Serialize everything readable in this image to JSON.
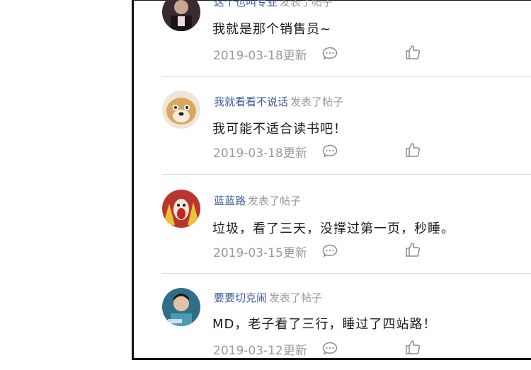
{
  "posts": [
    {
      "username": "这个也叫专业",
      "action": "发表了帖子",
      "content": "我就是那个销售员~",
      "date": "2019-03-18更新",
      "comment_icon": "comment-icon",
      "like_icon": "thumbs-up-icon"
    },
    {
      "username": "我就看看不说话",
      "action": "发表了帖子",
      "content": "我可能不适合读书吧！",
      "date": "2019-03-18更新",
      "comment_icon": "comment-icon",
      "like_icon": "thumbs-up-icon"
    },
    {
      "username": "蓝蓝路",
      "action": "发表了帖子",
      "content": "垃圾，看了三天，没撑过第一页，秒睡。",
      "date": "2019-03-15更新",
      "comment_icon": "comment-icon",
      "like_icon": "thumbs-up-icon"
    },
    {
      "username": "要要切克闹",
      "action": "发表了帖子",
      "content": "MD，老子看了三行，睡过了四站路！",
      "date": "2019-03-12更新",
      "comment_icon": "comment-icon",
      "like_icon": "thumbs-up-icon"
    }
  ],
  "colors": {
    "username": "#3e5a9a",
    "muted": "#9a9a9a",
    "text": "#1a1a1a"
  }
}
